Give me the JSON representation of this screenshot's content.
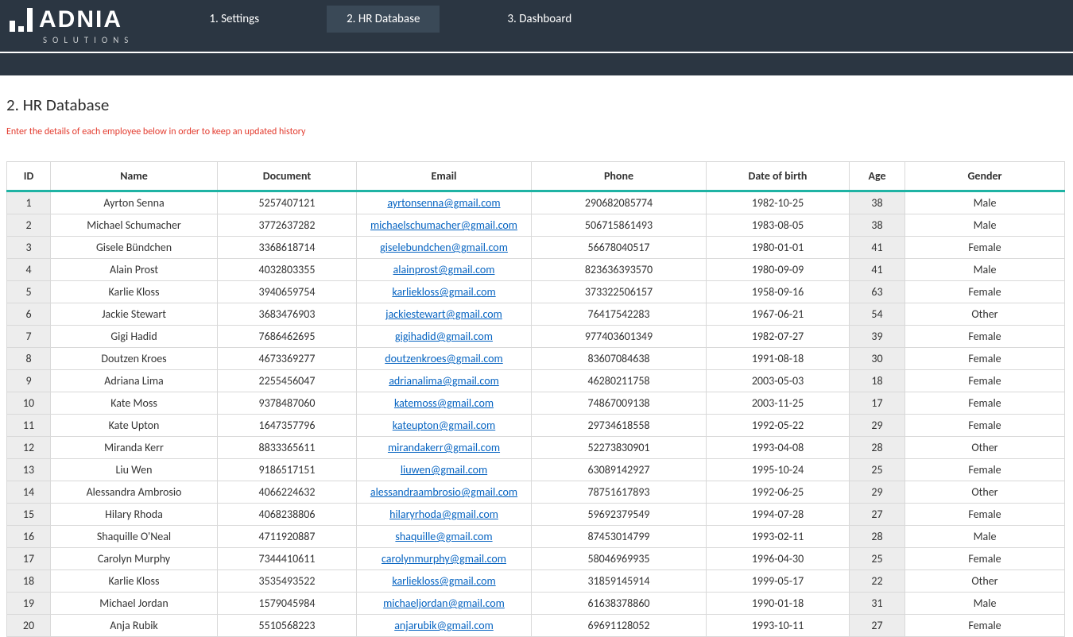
{
  "brand": {
    "name": "ADNIA",
    "sub": "SOLUTIONS"
  },
  "nav": {
    "settings": "1. Settings",
    "hrdb": "2. HR Database",
    "dashboard": "3. Dashboard"
  },
  "page": {
    "title": "2. HR Database",
    "instruction": "Enter the details of each employee below in order to keep an updated history"
  },
  "headers": {
    "id": "ID",
    "name": "Name",
    "document": "Document",
    "email": "Email",
    "phone": "Phone",
    "dob": "Date of birth",
    "age": "Age",
    "gender": "Gender"
  },
  "rows": [
    {
      "id": "1",
      "name": "Ayrton Senna",
      "document": "5257407121",
      "email": "ayrtonsenna@gmail.com",
      "phone": "290682085774",
      "dob": "1982-10-25",
      "age": "38",
      "gender": "Male"
    },
    {
      "id": "2",
      "name": "Michael Schumacher",
      "document": "3772637282",
      "email": "michaelschumacher@gmail.com",
      "phone": "506715861493",
      "dob": "1983-08-05",
      "age": "38",
      "gender": "Male"
    },
    {
      "id": "3",
      "name": "Gisele Bündchen",
      "document": "3368618714",
      "email": "giselebundchen@gmail.com",
      "phone": "56678040517",
      "dob": "1980-01-01",
      "age": "41",
      "gender": "Female"
    },
    {
      "id": "4",
      "name": "Alain Prost",
      "document": "4032803355",
      "email": "alainprost@gmail.com",
      "phone": "823636393570",
      "dob": "1980-09-09",
      "age": "41",
      "gender": "Male"
    },
    {
      "id": "5",
      "name": "Karlie Kloss",
      "document": "3940659754",
      "email": "karliekloss@gmail.com",
      "phone": "373322506157",
      "dob": "1958-09-16",
      "age": "63",
      "gender": "Female"
    },
    {
      "id": "6",
      "name": "Jackie Stewart",
      "document": "3683476903",
      "email": "jackiestewart@gmail.com",
      "phone": "76417542283",
      "dob": "1967-06-21",
      "age": "54",
      "gender": "Other"
    },
    {
      "id": "7",
      "name": "Gigi Hadid",
      "document": "7686462695",
      "email": "gigihadid@gmail.com",
      "phone": "977403601349",
      "dob": "1982-07-27",
      "age": "39",
      "gender": "Female"
    },
    {
      "id": "8",
      "name": "Doutzen Kroes",
      "document": "4673369277",
      "email": "doutzenkroes@gmail.com",
      "phone": "83607084638",
      "dob": "1991-08-18",
      "age": "30",
      "gender": "Female"
    },
    {
      "id": "9",
      "name": "Adriana Lima",
      "document": "2255456047",
      "email": "adrianalima@gmail.com",
      "phone": "46280211758",
      "dob": "2003-05-03",
      "age": "18",
      "gender": "Female"
    },
    {
      "id": "10",
      "name": "Kate Moss",
      "document": "9378487060",
      "email": "katemoss@gmail.com",
      "phone": "74867009138",
      "dob": "2003-11-25",
      "age": "17",
      "gender": "Female"
    },
    {
      "id": "11",
      "name": "Kate Upton",
      "document": "1647357796",
      "email": "kateupton@gmail.com",
      "phone": "29734618558",
      "dob": "1992-05-22",
      "age": "29",
      "gender": "Female"
    },
    {
      "id": "12",
      "name": "Miranda Kerr",
      "document": "8833365611",
      "email": "mirandakerr@gmail.com",
      "phone": "52273830901",
      "dob": "1993-04-08",
      "age": "28",
      "gender": "Other"
    },
    {
      "id": "13",
      "name": "Liu Wen",
      "document": "9186517151",
      "email": "liuwen@gmail.com",
      "phone": "63089142927",
      "dob": "1995-10-24",
      "age": "25",
      "gender": "Female"
    },
    {
      "id": "14",
      "name": "Alessandra Ambrosio",
      "document": "4066224632",
      "email": "alessandraambrosio@gmail.com",
      "phone": "78751617893",
      "dob": "1992-06-25",
      "age": "29",
      "gender": "Other"
    },
    {
      "id": "15",
      "name": "Hilary Rhoda",
      "document": "4068238806",
      "email": "hilaryrhoda@gmail.com",
      "phone": "59692379549",
      "dob": "1994-07-28",
      "age": "27",
      "gender": "Female"
    },
    {
      "id": "16",
      "name": "Shaquille O'Neal",
      "document": "4711920887",
      "email": "shaquille@gmail.com",
      "phone": "87453014799",
      "dob": "1993-02-11",
      "age": "28",
      "gender": "Male"
    },
    {
      "id": "17",
      "name": "Carolyn Murphy",
      "document": "7344410611",
      "email": "carolynmurphy@gmail.com",
      "phone": "58046969935",
      "dob": "1996-04-30",
      "age": "25",
      "gender": "Female"
    },
    {
      "id": "18",
      "name": "Karlie Kloss",
      "document": "3535493522",
      "email": "karliekloss@gmail.com",
      "phone": "31859145914",
      "dob": "1999-05-17",
      "age": "22",
      "gender": "Other"
    },
    {
      "id": "19",
      "name": "Michael Jordan",
      "document": "1579045984",
      "email": "michaeljordan@gmail.com",
      "phone": "61638378860",
      "dob": "1990-01-18",
      "age": "31",
      "gender": "Male"
    },
    {
      "id": "20",
      "name": "Anja Rubik",
      "document": "5510568223",
      "email": "anjarubik@gmail.com",
      "phone": "69691128052",
      "dob": "1993-10-11",
      "age": "27",
      "gender": "Female"
    }
  ]
}
